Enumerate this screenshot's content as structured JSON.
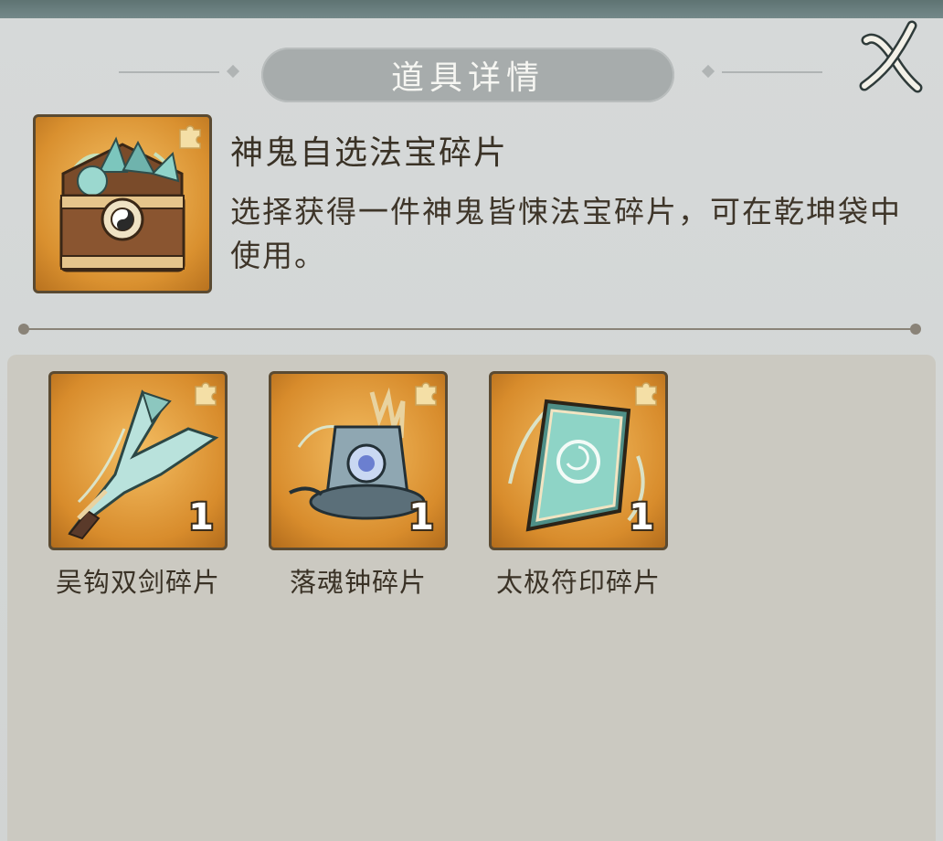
{
  "dialog": {
    "title": "道具详情",
    "close_icon": "close-x-icon"
  },
  "item": {
    "name": "神鬼自选法宝碎片",
    "description": "选择获得一件神鬼皆悚法宝碎片，可在乾坤袋中使用。",
    "icon": "treasure-chest-icon",
    "badge_icon": "puzzle-piece-icon"
  },
  "fragments": [
    {
      "name": "吴钩双剑碎片",
      "count": "1",
      "icon": "twin-sword-icon"
    },
    {
      "name": "落魂钟碎片",
      "count": "1",
      "icon": "bell-icon"
    },
    {
      "name": "太极符印碎片",
      "count": "1",
      "icon": "talisman-icon"
    }
  ],
  "colors": {
    "panel_bg": "#d6d9d9",
    "frame_gold": "#d9902f",
    "text_dark": "#3a3226",
    "accent_teal": "#6fb3ad"
  }
}
